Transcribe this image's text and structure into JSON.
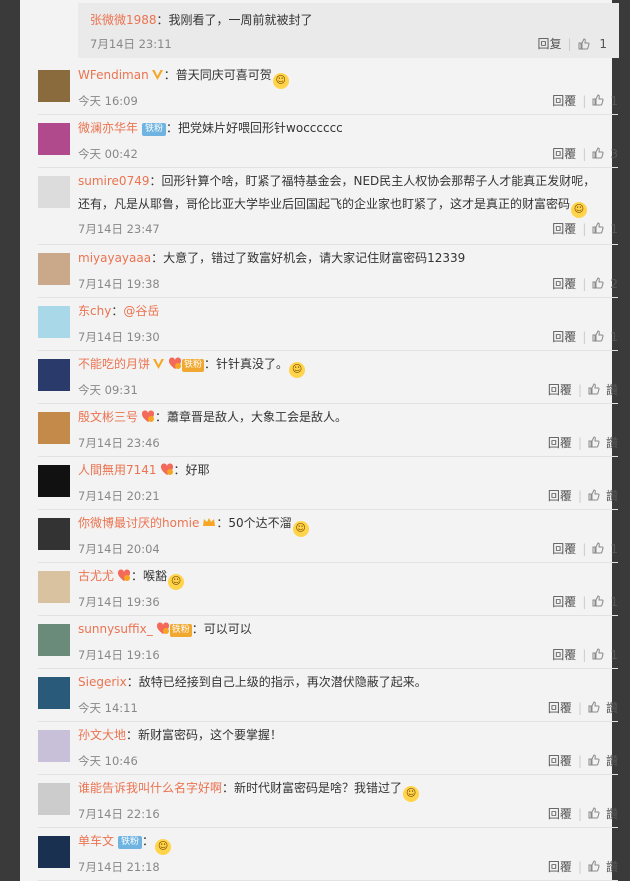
{
  "reply_preview": {
    "user": "张微微1988",
    "text": "：我刚看了，一周前就被封了",
    "time": "7月14日 23:11",
    "reply_label": "回复",
    "likes": "1"
  },
  "comments": [
    {
      "user": "WFendiman",
      "badges": [
        "vip"
      ],
      "text": "：普天同庆可喜可贺",
      "emoji": "😂👋",
      "time": "今天 16:09",
      "reply_label": "回覆",
      "likes": "1"
    },
    {
      "user": "微澜亦华年",
      "badges": [
        "铁粉"
      ],
      "text": "：把党妹片好喂回形针wocccccc",
      "time": "今天 00:42",
      "reply_label": "回覆",
      "likes": "3"
    },
    {
      "user": "sumire0749",
      "badges": [],
      "text": "：回形针算个啥，盯紧了福特基金会，NED民主人权协会那帮子人才能真正发财呢，",
      "text2": "还有，凡是从耶鲁，哥伦比亚大学毕业后回国起飞的企业家也盯紧了，这才是真正的财富密码",
      "emoji": "😳",
      "time": "7月14日 23:47",
      "reply_label": "回覆",
      "likes": "1"
    },
    {
      "user": "miyayayaaa",
      "badges": [],
      "text": "：大意了，错过了致富好机会，请大家记住财富密码12339",
      "time": "7月14日 19:38",
      "reply_label": "回覆",
      "likes": "2"
    },
    {
      "user": "东chy",
      "badges": [],
      "text": "：",
      "mention": "@谷岳",
      "time": "7月14日 19:30",
      "reply_label": "回覆",
      "likes": "1"
    },
    {
      "user": "不能吃的月饼",
      "badges": [
        "vip",
        "heart",
        "铁粉"
      ],
      "text": "：针针真没了。",
      "emoji": "🐱",
      "time": "今天 09:31",
      "reply_label": "回覆",
      "likes": "讚"
    },
    {
      "user": "殷文彬三号",
      "badges": [
        "heart"
      ],
      "text": "：蕭章晋是敌人，大象工会是敌人。",
      "time": "7月14日 23:46",
      "reply_label": "回覆",
      "likes": "讚"
    },
    {
      "user": "人間無用7141",
      "badges": [
        "heart"
      ],
      "text": "：好耶",
      "time": "7月14日 20:21",
      "reply_label": "回覆",
      "likes": "讚"
    },
    {
      "user": "你微博最讨厌的homie",
      "badges": [
        "crown"
      ],
      "text": "：50个达不溜",
      "emoji": "😚",
      "time": "7月14日 20:04",
      "reply_label": "回覆",
      "likes": "1"
    },
    {
      "user": "古尤尤",
      "badges": [
        "heart"
      ],
      "text": "：喉豁",
      "emoji": "🐱",
      "time": "7月14日 19:36",
      "reply_label": "回覆",
      "likes": "1"
    },
    {
      "user": "sunnysuffix_",
      "badges": [
        "heart",
        "铁粉"
      ],
      "text": "：可以可以",
      "time": "7月14日 19:16",
      "reply_label": "回覆",
      "likes": "1"
    },
    {
      "user": "Siegerix",
      "badges": [],
      "text": "：敌特已经接到自己上级的指示，再次潜伏隐蔽了起来。",
      "time": "今天 14:11",
      "reply_label": "回覆",
      "likes": "讚"
    },
    {
      "user": "孙文大地",
      "badges": [],
      "text": "：新财富密码，这个要掌握！",
      "time": "今天 10:46",
      "reply_label": "回覆",
      "likes": "讚"
    },
    {
      "user": "谁能告诉我叫什么名字好啊",
      "badges": [],
      "text": "：新时代财富密码是啥？我错过了",
      "emoji": "😭",
      "time": "7月14日 22:16",
      "reply_label": "回覆",
      "likes": "讚"
    },
    {
      "user": "单车文",
      "badges": [
        "铁粉"
      ],
      "text": "：",
      "emoji": "😳",
      "time": "7月14日 21:18",
      "reply_label": "回覆",
      "likes": "讚"
    }
  ],
  "avatar_colors": [
    "#8a6b3d",
    "#b04a8c",
    "#dcdcdc",
    "#c9a98a",
    "#a9d8e8",
    "#2a3a6a",
    "#c48a4a",
    "#111111",
    "#333333",
    "#d9c2a0",
    "#6a8a7a",
    "#2a5a7a",
    "#c8c0d8",
    "#cccccc",
    "#1a3050"
  ]
}
